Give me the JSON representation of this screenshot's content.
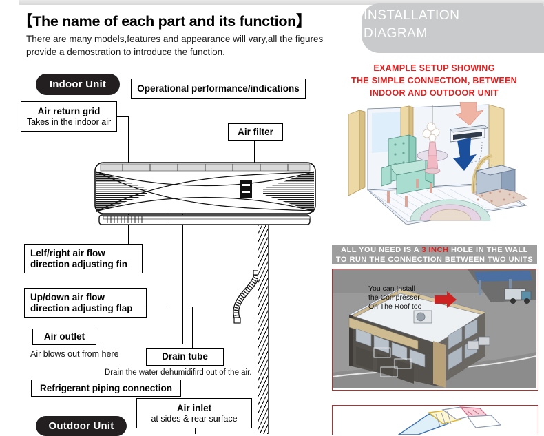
{
  "page": {
    "title": "【The name of each part and its function】",
    "intro": "There are many models,features and appearance will  vary,all the figures provide a demostration to introduce the function."
  },
  "left_diagram": {
    "indoor_unit_pill": "Indoor  Unit",
    "outdoor_unit_pill": "Outdoor Unit",
    "labels": [
      {
        "name": "air-return-grid",
        "title": "Air return grid",
        "sub": "Takes in the indoor air"
      },
      {
        "name": "operational-performance",
        "title": "Operational performance/indications",
        "sub": ""
      },
      {
        "name": "air-filter",
        "title": "Air filter",
        "sub": ""
      },
      {
        "name": "left-right-air-flow",
        "title": "Lelf/right air flow",
        "sub": "direction adjusting fin"
      },
      {
        "name": "up-down-air-flow",
        "title": "Up/down air flow",
        "sub": "direction adjusting flap"
      },
      {
        "name": "air-outlet",
        "title": "Air outlet",
        "sub": ""
      },
      {
        "name": "drain-tube",
        "title": "Drain tube",
        "sub": ""
      },
      {
        "name": "refrigerant-piping",
        "title": "Refrigerant piping connection",
        "sub": ""
      },
      {
        "name": "air-inlet",
        "title": "Air inlet",
        "sub": "at sides &  rear surface"
      }
    ],
    "captions": {
      "air_outlet_caption": "Air blows out from here",
      "drain_tube_caption": "Drain the water dehumidifird out of the air."
    }
  },
  "right_panel": {
    "banner_line1": "INSTALLATION",
    "banner_line2": "DIAGRAM",
    "red_heading_line1": "EXAMPLE SETUP SHOWING",
    "red_heading_line2": "THE SIMPLE CONNECTION, BETWEEN",
    "red_heading_line3": "INDOOR AND OUTDOOR UNIT",
    "gray_band_pre": "ALL YOU NEED IS A ",
    "gray_band_red": "3 INCH",
    "gray_band_post": " HOLE IN THE WALL",
    "gray_band_line2": "TO RUN THE CONNECTION BETWEEN TWO UNITS",
    "roof_note_line1": "You can Install",
    "roof_note_line2": "the Compressor",
    "roof_note_line3": "On The Roof too"
  },
  "colors": {
    "pill_bg": "#231f20",
    "red_heading": "#e02020",
    "banner_bg": "#c9cacc",
    "gray_band_bg": "#9e9e9e",
    "photo_border": "#b03030",
    "chair_green": "#a8ddcf",
    "wall_tan": "#e8d9a8"
  }
}
